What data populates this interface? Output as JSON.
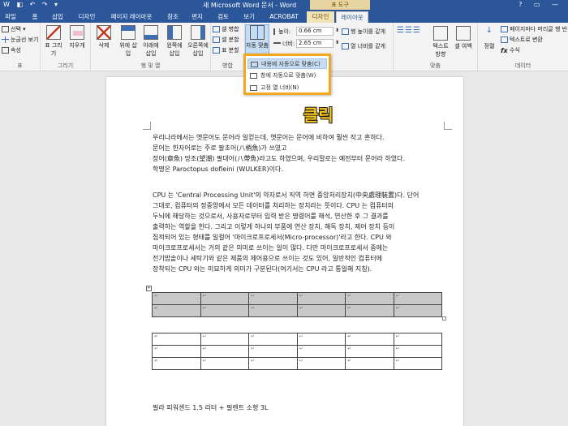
{
  "titlebar": {
    "quick_access": "W ◧ ↶ ↷ ▾",
    "title": "새 Microsoft Word 문서 - Word",
    "context_group": "표 도구",
    "window_controls": "? ▭ —"
  },
  "tabs": [
    {
      "label": "파일"
    },
    {
      "label": "홈"
    },
    {
      "label": "삽입"
    },
    {
      "label": "디자인"
    },
    {
      "label": "페이지 레이아웃"
    },
    {
      "label": "참조"
    },
    {
      "label": "편지"
    },
    {
      "label": "검토"
    },
    {
      "label": "보기"
    },
    {
      "label": "ACROBAT"
    },
    {
      "label": "디자인"
    },
    {
      "label": "레이아웃"
    }
  ],
  "ribbon": {
    "table_group": {
      "items": [
        "선택 ▾",
        "눈금선 보기",
        "속성"
      ],
      "label": "표"
    },
    "draw_group": {
      "items": [
        "표 그리기",
        "지우개"
      ],
      "label": "그리기"
    },
    "rows_group": {
      "items": [
        "삭제",
        "위에 삽입",
        "아래에 삽입",
        "왼쪽에 삽입",
        "오른쪽에 삽입"
      ],
      "label": "행 및 열"
    },
    "merge_group": {
      "items": [
        "셀 병합",
        "셀 분할",
        "표 분할"
      ],
      "label": "병합"
    },
    "autofit": {
      "label": "자동 맞춤"
    },
    "size_group": {
      "height_label": "높이:",
      "height_value": "0.66 cm",
      "width_label": "너비:",
      "width_value": "2.65 cm",
      "distribute_rows": "행 높이를 같게",
      "distribute_cols": "열 너비를 같게"
    },
    "align_group": {
      "items": [
        "텍스트 방향",
        "셀 여백"
      ],
      "label": "맞춤"
    },
    "data_group": {
      "items": [
        "정렬",
        "페이지마다 머리글 행 반복",
        "텍스트로 변환",
        "수식"
      ],
      "label": "데이터"
    }
  },
  "autofit_menu": [
    {
      "label": "내용에 자동으로 맞춤(C)"
    },
    {
      "label": "창에 자동으로 맞춤(W)"
    },
    {
      "label": "고정 열 너비(N)"
    }
  ],
  "annotation": {
    "text": "클릭"
  },
  "document": {
    "paragraph1": [
      "우리나라에서는 옛문어도 문어라 일컫는데, 옛문어는 문어에 비하여 훨씬 작고 흔하다.",
      "문어는 한자어로는 주로 팔초어(八梢魚)가 쓰였고",
      "장어(章魚) 망조(望潮) 팔대어(八帶魚)라고도 하였으며, 우리말로는 예전부터 문어라 하였다.",
      "학명은 Paroctopus dofleini (WULKER)이다."
    ],
    "paragraph2": [
      "CPU 는 'Central Processing Unit'의 약자로서 직역 하면 중앙처리장치(中央處理裝置)다. 단어",
      "그대로, 컴퓨터의 정중앙에서 모든 데이터를 처리하는 장치라는 뜻이다. CPU 는 컴퓨터의",
      "두뇌에 해당하는 것으로서, 사용자로부터 입력 받은 명령어를 해석, 연산한 후 그 결과를",
      "출력하는 역할을 한다. 그리고 이렇게 하나의 부품에 연산 장치, 해독 장치, 제어 장치 등이",
      "집적되어 있는 형태를 일컬어 '마이크로프로세서(Micro-processor)'라고 한다. CPU 와",
      "마이크로프로세서는 거의 같은 의미로 쓰이는 일이 많다. 다만 마이크로프로세서 중에는",
      "전기밥솥이나 세탁기와 같은 제품의 제어용으로 쓰이는 것도 있어, 일반적인 컴퓨터에",
      "장착되는 CPU 와는 미묘하게 의미가 구분된다(여기서는 CPU 라고 통일해 지칭)."
    ],
    "footer_text": "필라 피워센드 1.5 리터 + 필렌트 소형 3L"
  }
}
